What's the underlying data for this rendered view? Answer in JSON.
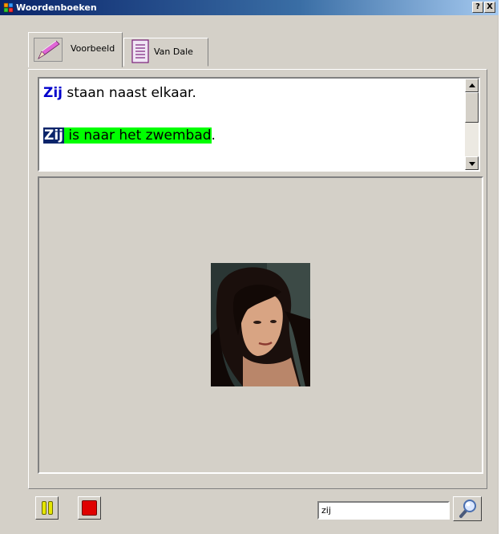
{
  "window": {
    "title": "Woordenboeken",
    "help_label": "?",
    "close_label": "X"
  },
  "tabs": [
    {
      "label": "Voorbeeld",
      "icon": "pencil-icon",
      "selected": true
    },
    {
      "label": "Van Dale",
      "icon": "document-icon",
      "selected": false
    }
  ],
  "sentences": {
    "line1": {
      "highlight": "Zij",
      "rest": " staan naast elkaar."
    },
    "line2": {
      "selected": "Zij",
      "green": " is naar het zwembad",
      "end": "."
    }
  },
  "colors": {
    "word_blue": "#0000cc",
    "selection": "#0a246a",
    "green_highlight": "#00ff00",
    "pause_yellow": "#e6e600",
    "stop_red": "#e00000"
  },
  "controls": {
    "pause_icon": "pause-icon",
    "stop_icon": "stop-icon",
    "search_icon": "magnifier-icon",
    "search_value": "zij"
  }
}
